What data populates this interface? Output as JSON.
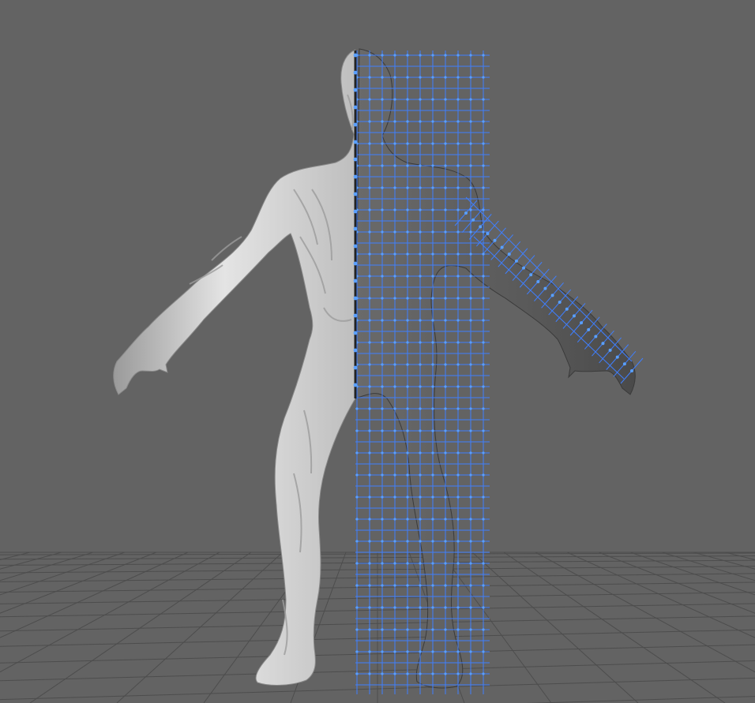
{
  "viewport": {
    "background_color": "#636363",
    "floor_grid_color": "#4d4d4d",
    "wire_color": "#3f7fff",
    "vertex_color": "#5aa0ff",
    "sculpt_color": "#d6d6d6",
    "retopo_mesh_color": "#5b5b5b",
    "symmetry_seam_color": "#222222"
  },
  "scene": {
    "floor_grid": "perspective-floor-grid",
    "sculpted_half": "high-poly-sculpt",
    "retopology_half": "low-poly-retopology-mesh",
    "show_floor_grid": true,
    "show_vertices": true
  }
}
